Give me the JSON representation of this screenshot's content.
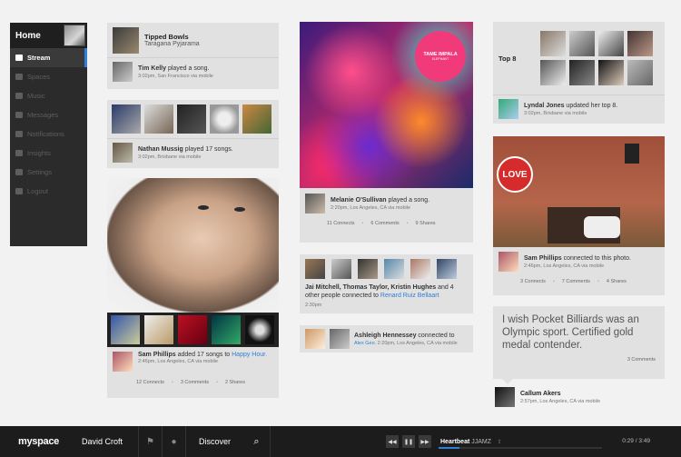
{
  "sidebar": {
    "home": "Home",
    "items": [
      {
        "label": "Stream",
        "icon": "stream-icon"
      },
      {
        "label": "Spaces",
        "icon": "spaces-icon"
      },
      {
        "label": "Music",
        "icon": "music-icon"
      },
      {
        "label": "Messages",
        "icon": "messages-icon"
      },
      {
        "label": "Notifications",
        "icon": "notifications-icon"
      },
      {
        "label": "Insights",
        "icon": "insights-icon"
      },
      {
        "label": "Settings",
        "icon": "settings-icon"
      },
      {
        "label": "Logout",
        "icon": "logout-icon"
      }
    ]
  },
  "col1": {
    "card1": {
      "title": "Tipped Bowls",
      "subtitle": "Taragana Pyjarama",
      "name": "Tim Kelly",
      "action": " played a song.",
      "meta": "3:02pm, San Francisco via mobile"
    },
    "card2": {
      "name": "Nathan Mussig",
      "action": " played 17 songs.",
      "meta": "3:02pm, Brisbane via mobile"
    },
    "card3": {
      "name": "Sam Phillips",
      "action": " added 17 songs to ",
      "link": "Happy Hour",
      "meta": ". 2:46pm, Los Angeles, CA via mobile",
      "connects": "12 Connects",
      "comments": "3 Comments",
      "shares": "2 Shares"
    }
  },
  "col2": {
    "album_label": "TAME IMPALA",
    "album_sub": "ELEPHANT",
    "card1": {
      "name": "Melanie O'Sullivan",
      "action": " played a song.",
      "meta": "2:20pm, Los Angeles, CA via mobile",
      "connects": "11 Connects",
      "comments": "6 Comments",
      "shares": "9 Shares"
    },
    "card2": {
      "names": "Jai Mitchell, Thomas Taylor, Kristin Hughes",
      "action": " and 4 other people connected to ",
      "link": "Renard Ruiz Bellaart",
      "meta": "2:30pm"
    },
    "card3": {
      "name": "Ashleigh Hennessey",
      "action": " connected to ",
      "link": "Alex Geo",
      "meta": ". 2:20pm, Los Angeles, CA via mobile"
    }
  },
  "col3": {
    "top8": "Top 8",
    "card1": {
      "name": "Lyndal Jones",
      "action": " updated her top 8.",
      "meta": "3:02pm, Brisbane via mobile"
    },
    "card2": {
      "name": "Sam Phillips",
      "action": " connected to this photo.",
      "meta": "2:46pm, Los Angeles, CA via mobile",
      "connects": "3 Connects",
      "comments": "7 Comments",
      "shares": "4 Shares",
      "love": "LOVE"
    },
    "quote": {
      "text": "I wish Pocket Billiards was an Olympic sport. Certified gold medal contender.",
      "comments": "3 Comments",
      "name": "Callum Akers",
      "meta": "2:57pm, Los Angeles, CA via mobile"
    }
  },
  "bottombar": {
    "logo": "myspace",
    "user": "David Croft",
    "discover": "Discover",
    "track": "Heartbeat",
    "artist": "JJAMZ",
    "time": "0:29 / 3:49",
    "progress": 0.13
  }
}
